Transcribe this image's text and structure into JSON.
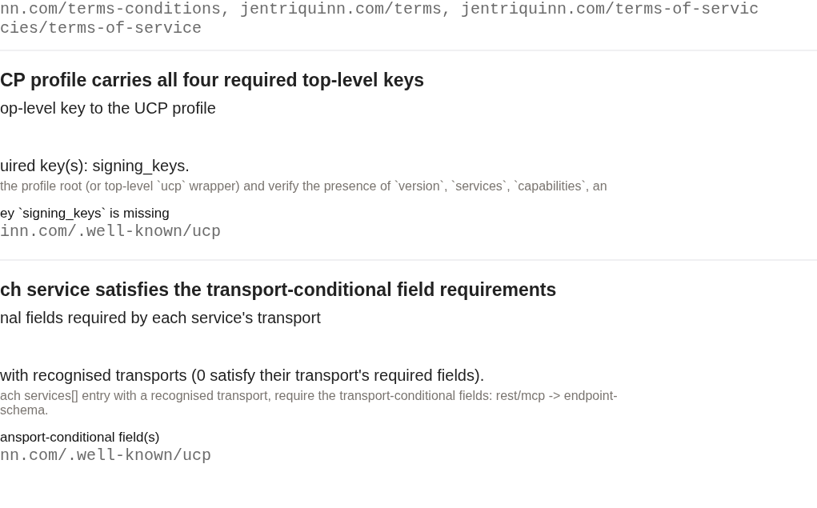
{
  "header_lines": [
    "nn.com/terms-conditions, jentriquinn.com/terms, jentriquinn.com/terms-of-servic",
    "cies/terms-of-service"
  ],
  "checks": [
    {
      "title": "CP profile carries all four required top-level keys",
      "subtitle": "op-level key to the UCP profile",
      "result": "uired key(s): signing_keys.",
      "description": [
        "the profile root (or top-level `ucp` wrapper) and verify the presence of `version`, `services`, `capabilities`, an"
      ],
      "finding": "ey `signing_keys` is missing",
      "url": "inn.com/.well-known/ucp"
    },
    {
      "title": "ch service satisfies the transport-conditional field requirements",
      "subtitle": "nal fields required by each service's transport",
      "result": "with recognised transports (0 satisfy their transport's required fields).",
      "description": [
        "ach services[] entry with a recognised transport, require the transport-conditional fields: rest/mcp -> endpoint-",
        "schema."
      ],
      "finding": "ansport-conditional field(s)",
      "url": "nn.com/.well-known/ucp"
    }
  ]
}
